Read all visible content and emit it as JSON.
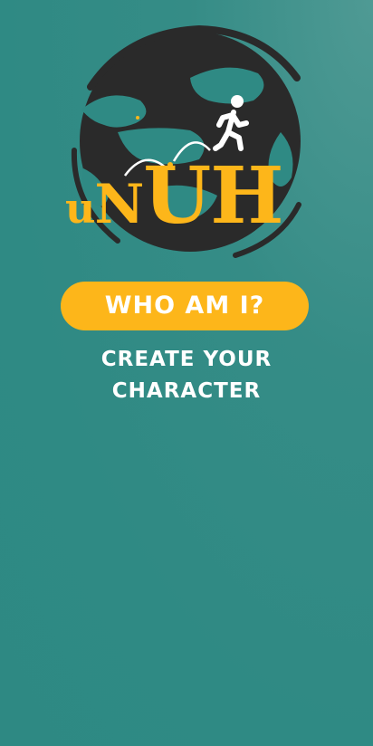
{
  "logo": {
    "text_small": "u",
    "text_big_1": "N",
    "text_big_2": "UH",
    "icon": "globe-runner-logo"
  },
  "main": {
    "button_label": "WHO AM I?",
    "subtitle_line1": "CREATE YOUR",
    "subtitle_line2": "CHARACTER"
  },
  "colors": {
    "background": "#2f8a84",
    "accent": "#fdb61a",
    "globe": "#2b2b2b",
    "text": "#ffffff"
  }
}
